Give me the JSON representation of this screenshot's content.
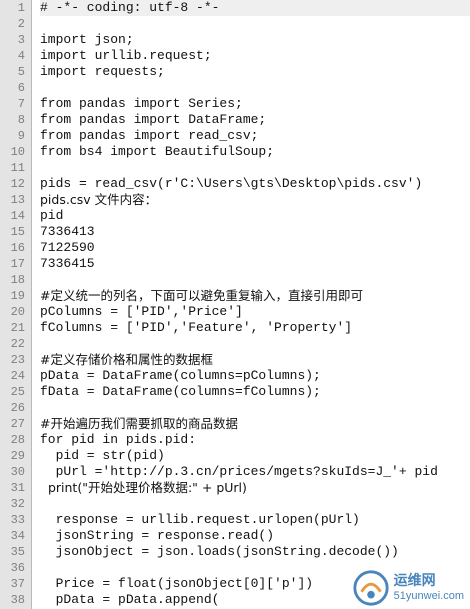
{
  "editor": {
    "lines": [
      "# -*- coding: utf-8 -*-",
      "",
      "import json;",
      "import urllib.request;",
      "import requests;",
      "",
      "from pandas import Series;",
      "from pandas import DataFrame;",
      "from pandas import read_csv;",
      "from bs4 import BeautifulSoup;",
      "",
      "pids = read_csv(r'C:\\Users\\gts\\Desktop\\pids.csv')",
      "pids.csv 文件内容：",
      "pid",
      "7336413",
      "7122590",
      "7336415",
      "",
      "#定义统一的列名，下面可以避免重复输入，直接引用即可",
      "pColumns = ['PID','Price']",
      "fColumns = ['PID','Feature', 'Property']",
      "",
      "#定义存储价格和属性的数据框",
      "pData = DataFrame(columns=pColumns);",
      "fData = DataFrame(columns=fColumns);",
      "",
      "#开始遍历我们需要抓取的商品数据",
      "for pid in pids.pid:",
      "  pid = str(pid)",
      "  pUrl ='http://p.3.cn/prices/mgets?skuIds=J_'+ pid",
      "  print(\"开始处理价格数据:\" + pUrl)",
      "",
      "  response = urllib.request.urlopen(pUrl)",
      "  jsonString = response.read()",
      "  jsonObject = json.loads(jsonString.decode())",
      "",
      "  Price = float(jsonObject[0]['p'])",
      "  pData = pData.append("
    ],
    "current_line": 1
  },
  "watermark": {
    "text_cn": "运维网",
    "text_url": "51yunwei.com"
  }
}
